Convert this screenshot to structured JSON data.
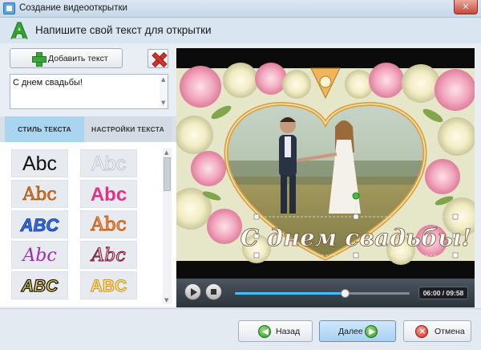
{
  "window": {
    "title": "Создание видеооткрытки",
    "close_glyph": "✕"
  },
  "header": {
    "heading": "Напишите свой текст для открытки",
    "logo_icon": "green-a-logo-icon"
  },
  "editor": {
    "add_text_label": "Добавить текст",
    "text_value": "С днем свадьбы!"
  },
  "tabs": [
    {
      "label": "СТИЛЬ ТЕКСТА",
      "active": true
    },
    {
      "label": "НАСТРОЙКИ ТЕКСТА",
      "active": false
    }
  ],
  "styles": [
    {
      "label": "Abc",
      "id": "plain-black"
    },
    {
      "label": "Abc",
      "id": "white-outline"
    },
    {
      "label": "Abc",
      "id": "orange-serif"
    },
    {
      "label": "Abc",
      "id": "pink-bold"
    },
    {
      "label": "ABC",
      "id": "blue-glossy"
    },
    {
      "label": "Abc",
      "id": "orange-outline"
    },
    {
      "label": "Abc",
      "id": "purple-script"
    },
    {
      "label": "Abc",
      "id": "maroon-outline"
    },
    {
      "label": "ABC",
      "id": "yellow-black"
    },
    {
      "label": "ABC",
      "id": "gold-glossy"
    }
  ],
  "preview": {
    "overlay_text": "С днем свадьбы!",
    "playback_progress": 0.63
  },
  "player": {
    "time": "06:00 / 09:58"
  },
  "footer": {
    "back_label": "Назад",
    "next_label": "Далее",
    "cancel_label": "Отмена"
  },
  "colors": {
    "accent_tab": "#a9d5f0",
    "progress_fill": "#4cb8ff",
    "overlay_text": "#ffffff"
  }
}
